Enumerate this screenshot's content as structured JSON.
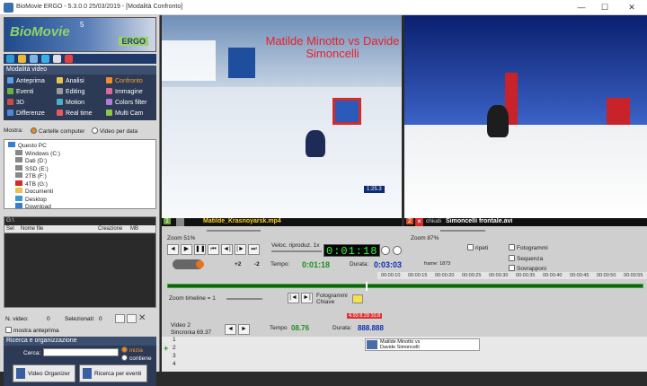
{
  "window": {
    "title": "BioMovie ERGO - 5.3.0.0  25/03/2019 - [Modalità Confronto]",
    "minimize": "—",
    "maximize": "☐",
    "close": "✕"
  },
  "logo": {
    "brand": "BioMovie",
    "sup": "5",
    "sub": "ERGO"
  },
  "modes": {
    "header": "Modalità video",
    "items": [
      {
        "label": "Anteprima",
        "sel": false
      },
      {
        "label": "Analisi",
        "sel": false
      },
      {
        "label": "Confronto",
        "sel": true
      },
      {
        "label": "Eventi",
        "sel": false
      },
      {
        "label": "Editing",
        "sel": false
      },
      {
        "label": "Immagine",
        "sel": false
      },
      {
        "label": "3D",
        "sel": false
      },
      {
        "label": "Motion",
        "sel": false
      },
      {
        "label": "Colors filter",
        "sel": false
      },
      {
        "label": "Differenze",
        "sel": false
      },
      {
        "label": "Real time",
        "sel": false
      },
      {
        "label": "Multi Cam",
        "sel": false
      }
    ]
  },
  "mostra": {
    "label": "Mostra:",
    "opt1": "Cartelle computer",
    "opt2": "Video per data"
  },
  "tree": [
    "Questo PC",
    "Windows (C:)",
    "Dati (D:)",
    "SSD (E:)",
    "2TB (F:)",
    "4TB (G:)",
    "Documenti",
    "Desktop",
    "Download"
  ],
  "files": {
    "path": "G:\\",
    "cols": [
      "Sel",
      "Nome file",
      "Creazione",
      "MB"
    ]
  },
  "counts": {
    "nvideo_label": "N. video:",
    "nvideo": "0",
    "sel_label": "Selezionati:",
    "sel": "0",
    "preview": "mostra anteprima"
  },
  "search": {
    "header": "Ricerca e organizzazione",
    "label": "Cerca:",
    "opt1": "inizia",
    "opt2": "contiene",
    "btn1": "Video Organizer",
    "btn2": "Ricerca per eventi"
  },
  "videos": {
    "left_overlay": "Matilde Minotto vs Davide Simoncelli",
    "left_index": "1",
    "left_file": "Matilde_Krasnoyarsk.mp4",
    "left_zoom": "Zoom 51%",
    "left_time": "1:25.3",
    "right_index": "2",
    "right_close": "chiudi",
    "right_file": "Simoncelli frontale.avi",
    "right_zoom": "Zoom 87%"
  },
  "controls": {
    "speed_label": "Veloc. riproduz. 1x",
    "lcd": "0:01:18",
    "plus": "+2",
    "minus": "-2",
    "tempo_label": "Tempo:",
    "tempo": "0:01:18",
    "durata_label": "Durata:",
    "durata": "0:03:03",
    "frame": "frame: 1873",
    "ripeti": "ripeti",
    "fotogrammi": "Fotogrammi",
    "sequenza": "Sequenza",
    "sovrapponi": "Sovrapponi",
    "zoom_timeline": "Zoom timeline = 1",
    "keyframes": "Fotogrammi Chiave",
    "markers": "4.93  8.29  10.8"
  },
  "ruler": [
    "00:00:10",
    "00:00:15",
    "00:00:20",
    "00:00:25",
    "00:00:30",
    "00:00:35",
    "00:00:40",
    "00:00:45",
    "00:00:50",
    "00:00:55"
  ],
  "track": {
    "video_label": "Video 2",
    "sync": "Sincronia 69.37",
    "tempo_label": "Tempo",
    "tempo": "08.76",
    "durata_label": "Durata:",
    "durata": "888.888",
    "rows": [
      "1",
      "2",
      "3",
      "4"
    ],
    "clip": "Matilde Minotto vs",
    "clip2": "Davide Simoncelli"
  }
}
